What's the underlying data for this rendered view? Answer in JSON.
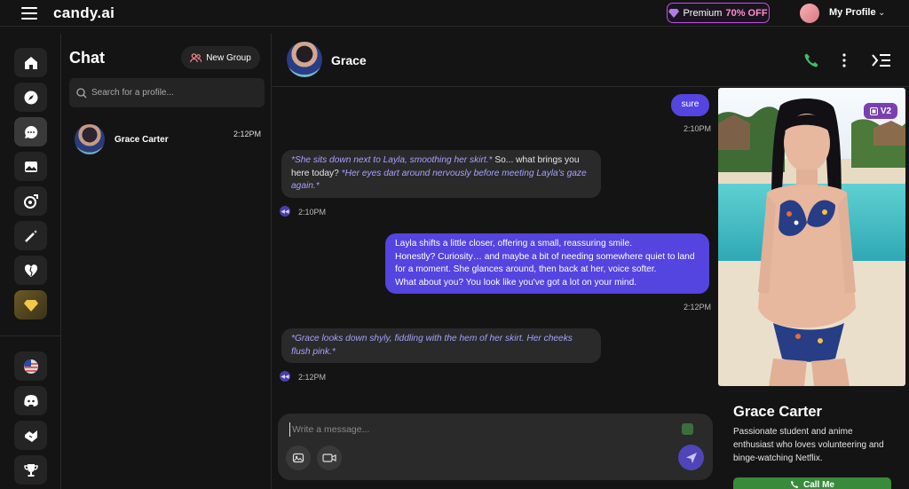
{
  "topbar": {
    "logo_main": "candy",
    "logo_suffix": ".ai",
    "premium_label": "Premium",
    "premium_discount": "70% OFF",
    "profile_label": "My Profile"
  },
  "rail": {
    "items": [
      "home-icon",
      "compass-icon",
      "chat-icon",
      "gallery-icon",
      "generate-icon",
      "magic-wand-icon",
      "heart-icon",
      "diamond-icon",
      "us-flag-icon",
      "discord-icon",
      "affiliate-icon",
      "trophy-icon"
    ]
  },
  "chatlist": {
    "title": "Chat",
    "new_group_label": "New Group",
    "search_placeholder": "Search for a profile...",
    "contacts": [
      {
        "name": "Grace Carter",
        "time": "2:12PM"
      }
    ]
  },
  "header": {
    "name": "Grace"
  },
  "messages": [
    {
      "from": "user",
      "text": "sure",
      "time": "2:10PM"
    },
    {
      "from": "bot",
      "parts": [
        {
          "act": "*She sits down next to Layla, smoothing her skirt.*"
        },
        {
          "text": " So... what brings you here today? "
        },
        {
          "act": "*Her eyes dart around nervously before meeting Layla's gaze again.*"
        }
      ],
      "time": "2:10PM"
    },
    {
      "from": "user",
      "lines": [
        "Layla shifts a little closer, offering a small, reassuring smile.",
        "Honestly? Curiosity… and maybe a bit of needing somewhere quiet to land for a moment. She glances around, then back at her, voice softer.",
        "What about you? You look like you've got a lot on your mind."
      ],
      "time": "2:12PM"
    },
    {
      "from": "bot",
      "parts": [
        {
          "act": "*Grace looks down shyly, fiddling with the hem of her skirt. Her cheeks flush pink.*"
        }
      ],
      "time": "2:12PM"
    }
  ],
  "composer": {
    "placeholder": "Write a message..."
  },
  "profile": {
    "badge": "V2",
    "name": "Grace Carter",
    "description": "Passionate student and anime enthusiast who loves volunteering and binge-watching Netflix.",
    "call_label": "Call Me"
  },
  "colors": {
    "accent": "#5444e0",
    "premium_border": "#c54de8",
    "call_green": "#3a8a3c"
  }
}
